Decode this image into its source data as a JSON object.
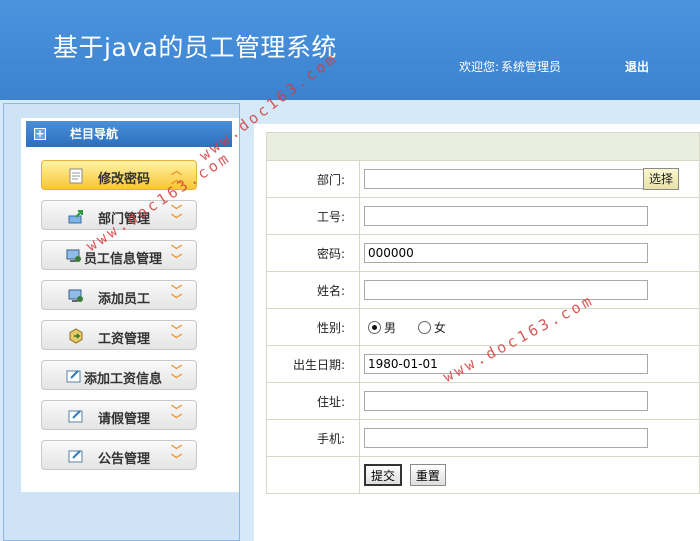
{
  "header": {
    "title": "基于java的员工管理系统",
    "welcome_label": "欢迎您:",
    "user_role": "系统管理员",
    "logout_label": "退出"
  },
  "sidebar": {
    "nav_title": "栏目导航",
    "items": [
      {
        "label": "修改密码",
        "icon": "notepad-icon",
        "active": true
      },
      {
        "label": "部门管理",
        "icon": "export-icon",
        "active": false
      },
      {
        "label": "员工信息管理",
        "icon": "computer-user-icon",
        "active": false
      },
      {
        "label": "添加员工",
        "icon": "computer-user-icon",
        "active": false
      },
      {
        "label": "工资管理",
        "icon": "hexagon-box-icon",
        "active": false
      },
      {
        "label": "添加工资信息",
        "icon": "edit-doc-icon",
        "active": false
      },
      {
        "label": "请假管理",
        "icon": "edit-doc-icon",
        "active": false
      },
      {
        "label": "公告管理",
        "icon": "edit-doc-icon",
        "active": false
      }
    ]
  },
  "form": {
    "department": {
      "label": "部门:",
      "value": "",
      "pick_label": "选择"
    },
    "employee_no": {
      "label": "工号:",
      "value": ""
    },
    "password": {
      "label": "密码:",
      "value": "000000"
    },
    "name": {
      "label": "姓名:",
      "value": ""
    },
    "gender": {
      "label": "性别:",
      "options": [
        "男",
        "女"
      ],
      "selected": "男"
    },
    "birthdate": {
      "label": "出生日期:",
      "value": "1980-01-01"
    },
    "address": {
      "label": "住址:",
      "value": ""
    },
    "phone": {
      "label": "手机:",
      "value": ""
    },
    "submit_label": "提交",
    "reset_label": "重置"
  },
  "watermark": "www.doc163.com"
}
